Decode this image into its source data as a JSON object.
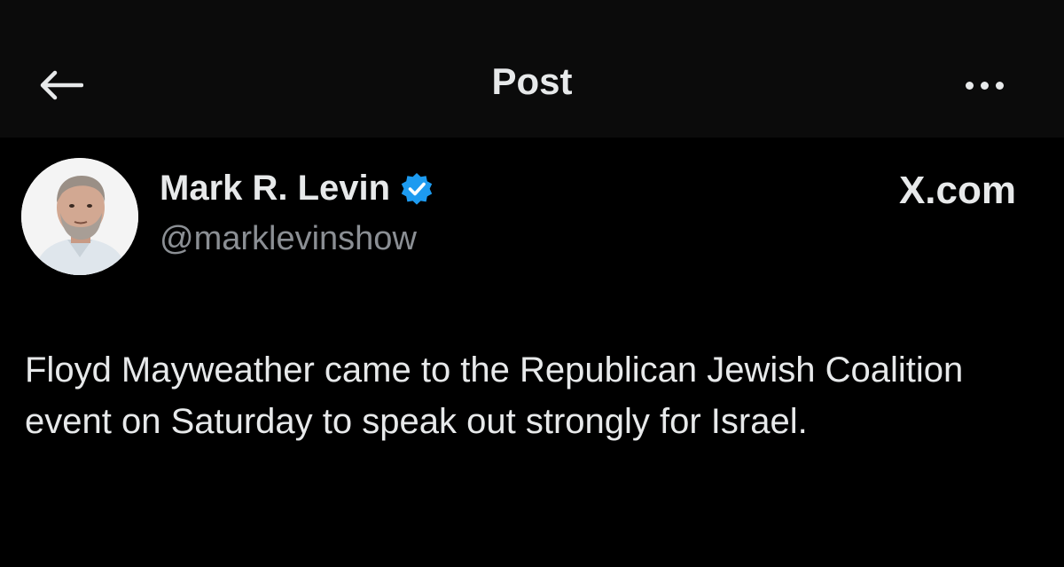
{
  "header": {
    "title": "Post",
    "back_icon": "arrow-left-icon",
    "more_icon": "more-horizontal-icon"
  },
  "author": {
    "display_name": "Mark R. Levin",
    "handle": "@marklevinshow",
    "verified": true,
    "verified_color": "#1d9bf0"
  },
  "source": {
    "label": "X.com"
  },
  "post": {
    "text": "Floyd Mayweather came to the Republican Jewish Coalition event on Saturday to speak out strongly for Israel."
  },
  "colors": {
    "background": "#000000",
    "header_background": "#0b0b0b",
    "primary_text": "#e7e9ea",
    "secondary_text": "#8b8f94"
  }
}
